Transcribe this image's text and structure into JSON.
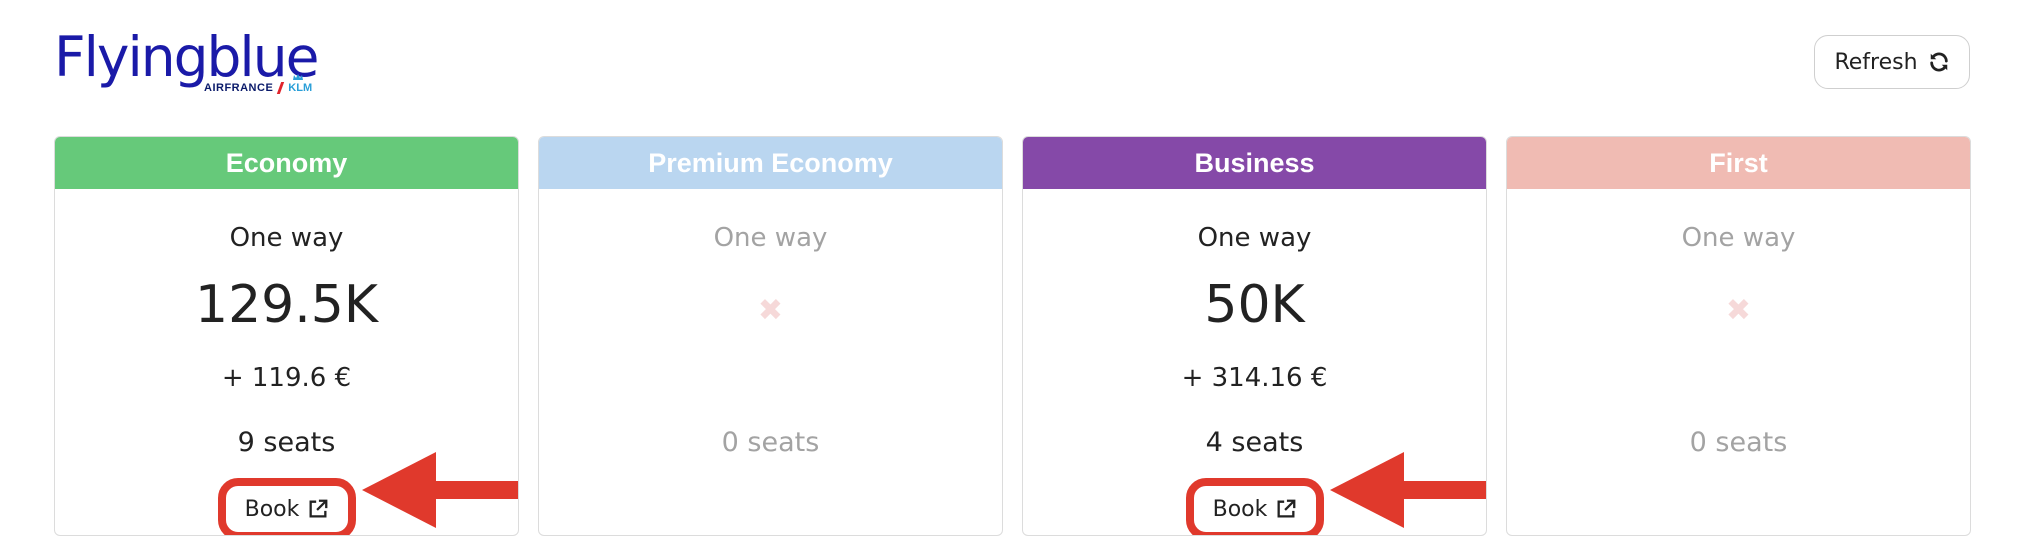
{
  "logo": {
    "wordmark": "Flyingblue",
    "airfrance": "AIRFRANCE",
    "klm": "KLM"
  },
  "header": {
    "refresh_label": "Refresh",
    "refresh_icon": "refresh-icon"
  },
  "cards": [
    {
      "title": "Economy",
      "color": "#66c97a",
      "trip": "One way",
      "miles": "129.5K",
      "taxes": "+ 119.6 €",
      "seats": "9 seats",
      "book_label": "Book",
      "available": true
    },
    {
      "title": "Premium Economy",
      "color": "#bad6f0",
      "trip": "One way",
      "unavailable_icon": "✖",
      "seats": "0 seats",
      "available": false
    },
    {
      "title": "Business",
      "color": "#8549a8",
      "trip": "One way",
      "miles": "50K",
      "taxes": "+ 314.16 €",
      "seats": "4 seats",
      "book_label": "Book",
      "available": true
    },
    {
      "title": "First",
      "color": "#f0bbb3",
      "trip": "One way",
      "unavailable_icon": "✖",
      "seats": "0 seats",
      "available": false
    }
  ],
  "annotation": {
    "highlight_color": "#e0392c"
  }
}
